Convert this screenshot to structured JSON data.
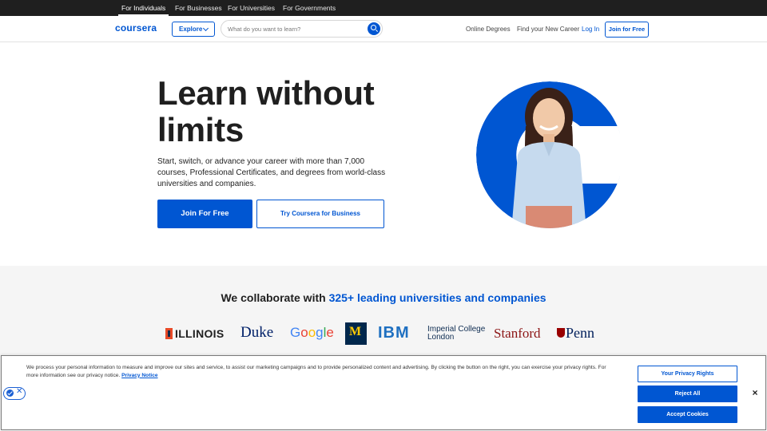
{
  "audience_tabs": [
    {
      "label": "For Individuals",
      "active": true
    },
    {
      "label": "For Businesses",
      "active": false
    },
    {
      "label": "For Universities",
      "active": false
    },
    {
      "label": "For Governments",
      "active": false
    }
  ],
  "header": {
    "logo": "coursera",
    "explore_label": "Explore",
    "search_placeholder": "What do you want to learn?",
    "nav_links": [
      "Online Degrees",
      "Find your New Career",
      "Log In"
    ],
    "join_label": "Join for Free",
    "accent_color": "#0056d2"
  },
  "hero": {
    "title_line1": "Learn without",
    "title_line2": "limits",
    "subtitle": "Start, switch, or advance your career with more than 7,000 courses, Professional Certificates, and degrees from world-class universities and companies.",
    "primary_cta": "Join For Free",
    "secondary_cta": "Try Coursera for Business"
  },
  "partners": {
    "heading_prefix": "We collaborate with ",
    "heading_link": "325+ leading universities and companies",
    "logos": [
      "ILLINOIS",
      "Duke",
      "Google",
      "M",
      "IBM",
      "Imperial College",
      "London",
      "Stanford",
      "Penn"
    ]
  },
  "cookie_banner": {
    "text": "We process your personal information to measure and improve our sites and service, to assist our marketing campaigns and to provide personalized content and advertising. By clicking the button on the right, you can exercise your privacy rights. For more information see our privacy notice. ",
    "privacy_link": "Privacy Notice",
    "buttons": {
      "privacy_rights": "Your Privacy Rights",
      "reject": "Reject All",
      "accept": "Accept Cookies"
    },
    "close_glyph": "×"
  }
}
